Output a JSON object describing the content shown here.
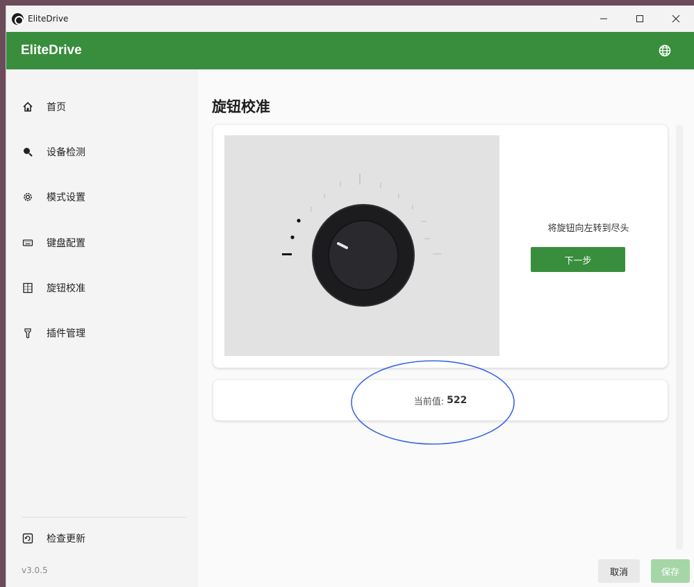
{
  "window": {
    "title": "EliteDrive"
  },
  "appbar": {
    "app_name": "EliteDrive",
    "language_icon": "globe-icon"
  },
  "sidebar": {
    "items": [
      {
        "label": "首页",
        "icon": "home-icon"
      },
      {
        "label": "设备检测",
        "icon": "magnifier-icon"
      },
      {
        "label": "模式设置",
        "icon": "gear-icon"
      },
      {
        "label": "键盘配置",
        "icon": "keyboard-icon"
      },
      {
        "label": "旋钮校准",
        "icon": "knob-grid-icon"
      },
      {
        "label": "插件管理",
        "icon": "plugin-icon"
      }
    ],
    "update_label": "检查更新",
    "version": "v3.0.5"
  },
  "main": {
    "page_title": "旋钮校准",
    "instruction": "将旋钮向左转到尽头",
    "next_label": "下一步",
    "current_value_label": "当前值:",
    "current_value": "522",
    "cancel_label": "取消",
    "save_label": "保存"
  },
  "colors": {
    "brand_green": "#388e3c",
    "save_disabled": "#a5d6a7",
    "highlight_ring": "#3a66e8"
  }
}
